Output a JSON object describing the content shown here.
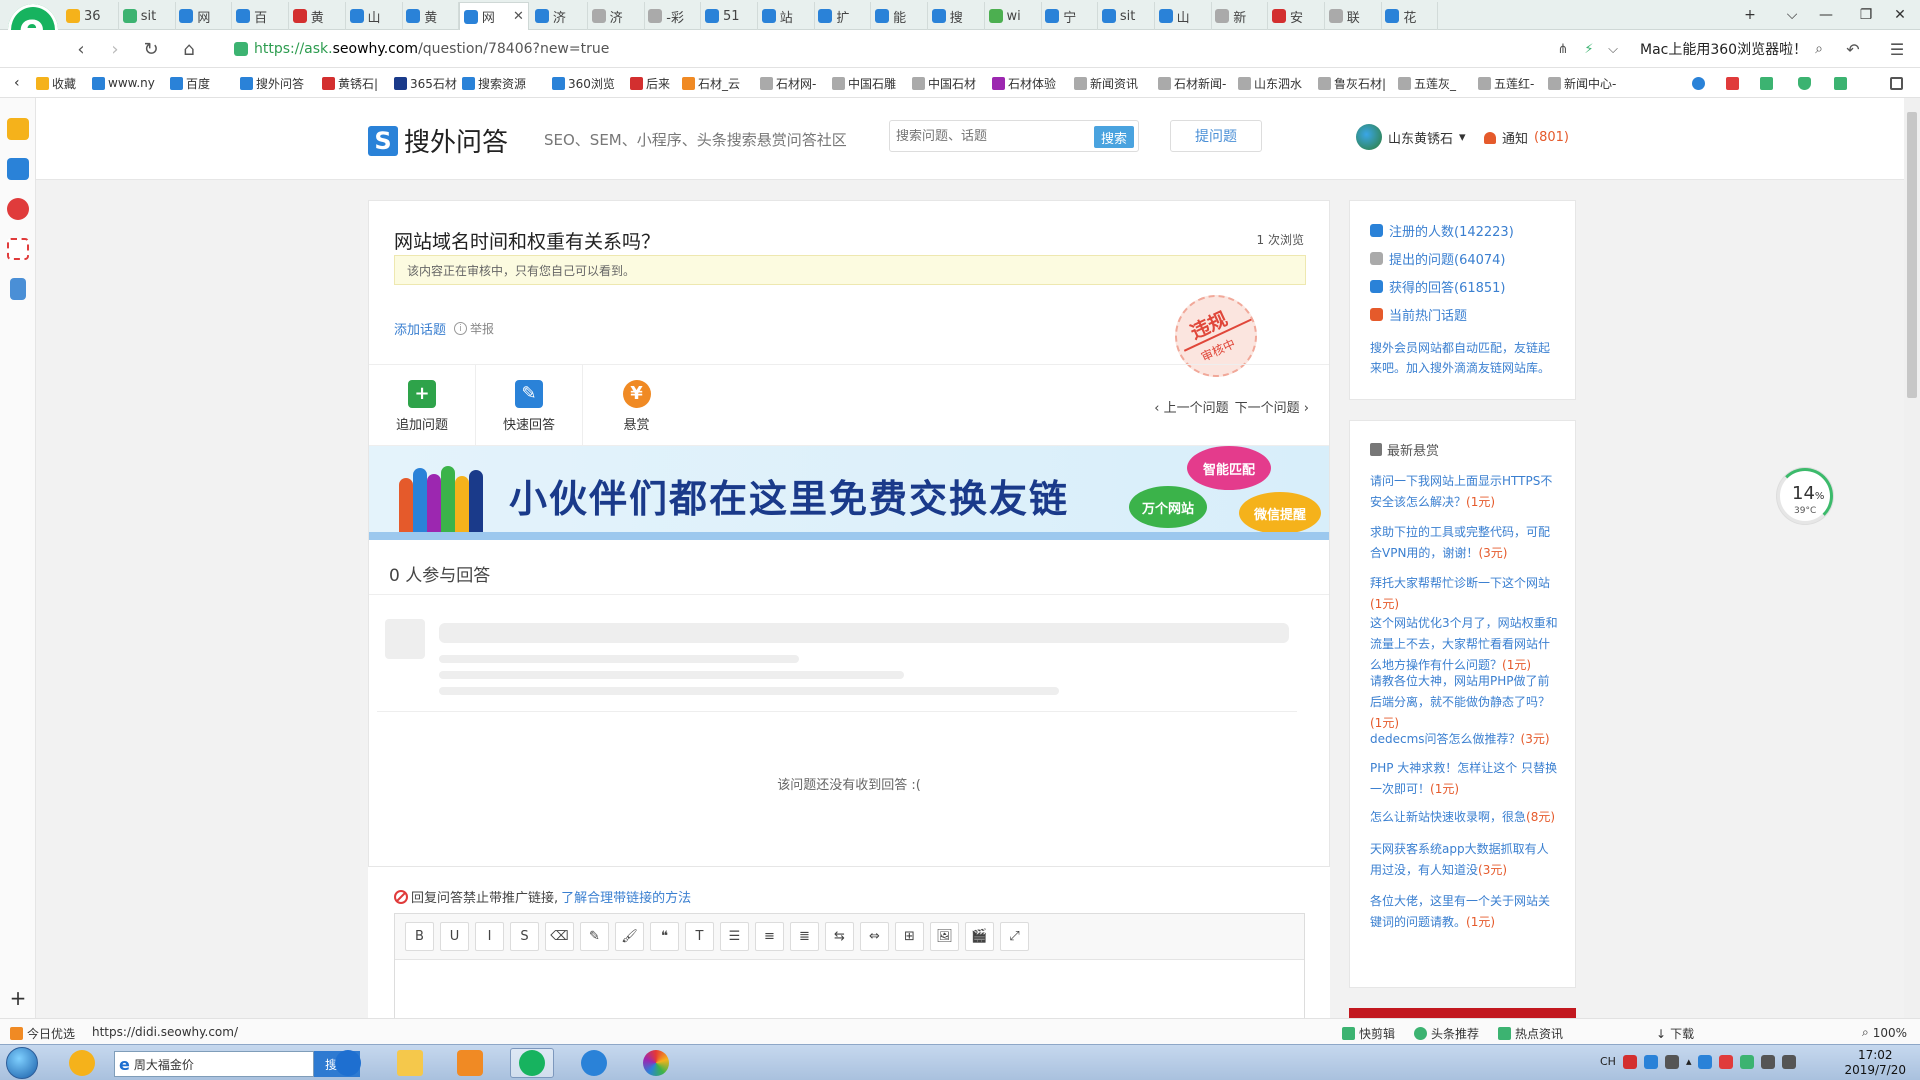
{
  "browser": {
    "tabs": [
      {
        "label": "36",
        "icon": "360-icon",
        "color": "#f5b21b"
      },
      {
        "label": "sit",
        "icon": "loading-icon",
        "color": "#3cb371"
      },
      {
        "label": "网",
        "icon": "chart-icon",
        "color": "#2a82d8"
      },
      {
        "label": "百",
        "icon": "baidu-icon",
        "color": "#2a82d8"
      },
      {
        "label": "黄",
        "icon": "site-icon",
        "color": "#d32f2f"
      },
      {
        "label": "山",
        "icon": "s-icon",
        "color": "#2a82d8"
      },
      {
        "label": "黄",
        "icon": "baidu-icon",
        "color": "#2a82d8"
      },
      {
        "label": "网",
        "icon": "s-icon",
        "color": "#2a82d8"
      },
      {
        "label": "济",
        "icon": "baidu-icon",
        "color": "#2a82d8"
      },
      {
        "label": "济",
        "icon": "page-icon",
        "color": "#aaaaaa"
      },
      {
        "label": "-彩",
        "icon": "page-icon",
        "color": "#aaaaaa"
      },
      {
        "label": "51",
        "icon": "baidu-icon",
        "color": "#2a82d8"
      },
      {
        "label": "站",
        "icon": "seo-icon",
        "color": "#2a82d8"
      },
      {
        "label": "扩",
        "icon": "seo-icon",
        "color": "#2a82d8"
      },
      {
        "label": "能",
        "icon": "baidu-icon",
        "color": "#2a82d8"
      },
      {
        "label": "搜",
        "icon": "baidu-icon",
        "color": "#2a82d8"
      },
      {
        "label": "wi",
        "icon": "wiki-icon",
        "color": "#4caf50"
      },
      {
        "label": "宁",
        "icon": "baidu-icon",
        "color": "#2a82d8"
      },
      {
        "label": "sit",
        "icon": "baidu-icon",
        "color": "#2a82d8"
      },
      {
        "label": "山",
        "icon": "baidu-icon",
        "color": "#2a82d8"
      },
      {
        "label": "新",
        "icon": "page-icon",
        "color": "#aaaaaa"
      },
      {
        "label": "安",
        "icon": "site-icon",
        "color": "#d32f2f"
      },
      {
        "label": "联",
        "icon": "page-icon",
        "color": "#aaaaaa"
      },
      {
        "label": "花",
        "icon": "baidu-icon",
        "color": "#2a82d8"
      }
    ],
    "active_tab_index": 7,
    "url_green": "https://ask.",
    "url_dark": "seowhy.com",
    "url_rest": "/question/78406?new=true",
    "promo_text": "Mac上能用360浏览器啦！",
    "bookmarks": [
      {
        "label": "收藏",
        "color": "#f5b21b"
      },
      {
        "label": "www.ny",
        "color": "#2a82d8"
      },
      {
        "label": "百度",
        "color": "#2a82d8"
      },
      {
        "label": "搜外问答",
        "color": "#2a82d8"
      },
      {
        "label": "黄锈石|",
        "color": "#d32f2f"
      },
      {
        "label": "365石材",
        "color": "#1a3a8a"
      },
      {
        "label": "搜索资源",
        "color": "#2a82d8"
      },
      {
        "label": "360浏览",
        "color": "#2a82d8"
      },
      {
        "label": "后来",
        "color": "#d32f2f"
      },
      {
        "label": "石材_云",
        "color": "#f08a24"
      },
      {
        "label": "石材网-",
        "color": "#aaaaaa"
      },
      {
        "label": "中国石雕",
        "color": "#aaaaaa"
      },
      {
        "label": "中国石材",
        "color": "#aaaaaa"
      },
      {
        "label": "石材体验",
        "color": "#9c27b0"
      },
      {
        "label": "新闻资讯",
        "color": "#aaaaaa"
      },
      {
        "label": "石材新闻-",
        "color": "#aaaaaa"
      },
      {
        "label": "山东泗水",
        "color": "#aaaaaa"
      },
      {
        "label": "鲁灰石材|",
        "color": "#aaaaaa"
      },
      {
        "label": "五莲灰_",
        "color": "#aaaaaa"
      },
      {
        "label": "五莲红-",
        "color": "#aaaaaa"
      },
      {
        "label": "新闻中心-",
        "color": "#aaaaaa"
      }
    ]
  },
  "site": {
    "logo_letter": "S",
    "name": "搜外问答",
    "slogan": "SEO、SEM、小程序、头条搜索悬赏问答社区",
    "search_placeholder": "搜索问题、话题",
    "search_button": "搜索",
    "ask_button": "提问题",
    "username": "山东黄锈石",
    "notify_label": "通知",
    "notify_count": "(801)"
  },
  "question": {
    "title": "网站域名时间和权重有关系吗？",
    "views": "1 次浏览",
    "review_notice": "该内容正在审核中，只有您自己可以看到。",
    "add_topic": "添加话题",
    "report": "举报",
    "stamp_main": "违规",
    "stamp_sub": "审核中",
    "actions": [
      {
        "label": "追加问题",
        "icon": "add-question-icon",
        "color": "#2ea34a"
      },
      {
        "label": "快速回答",
        "icon": "quick-answer-icon",
        "color": "#2a82d8"
      },
      {
        "label": "悬赏",
        "icon": "bounty-bag-icon",
        "color": "#f08a24"
      }
    ],
    "prev": "上一个问题",
    "next": "下一个问题",
    "banner_slogan": "小伙伴们都在这里免费交换友链",
    "banner_tags": [
      "智能匹配",
      "万个网站",
      "微信提醒"
    ],
    "answers_count": "0 人参与回答",
    "no_answer": "该问题还没有收到回答 :(",
    "reply_notice": "回复问答禁止带推广链接,",
    "reply_link": "了解合理带链接的方法",
    "editor_tools": [
      "B",
      "U",
      "I",
      "S",
      "⌫",
      "✎",
      "🖌",
      "❝",
      "T",
      "☰",
      "≡",
      "≣",
      "⇆",
      "⇔",
      "⊞",
      "🖼",
      "🎬",
      "⤢"
    ]
  },
  "stats": {
    "items": [
      {
        "label": "注册的人数(142223)",
        "icon": "users-icon",
        "color": "#2a82d8"
      },
      {
        "label": "提出的问题(64074)",
        "icon": "chat-icon",
        "color": "#aaaaaa"
      },
      {
        "label": "获得的回答(61851)",
        "icon": "edit-icon",
        "color": "#2a82d8"
      },
      {
        "label": "当前热门话题",
        "icon": "fire-icon",
        "color": "#e55a2b"
      }
    ],
    "info": "搜外会员网站都自动匹配，友链起来吧。加入搜外滴滴友链网站库。"
  },
  "bounty": {
    "heading": "最新悬赏",
    "items": [
      {
        "text": "请问一下我网站上面显示HTTPS不安全该怎么解决？",
        "reward": "(1元)"
      },
      {
        "text": "求助下拉的工具或完整代码，可配合VPN用的，谢谢！",
        "reward": "(3元)"
      },
      {
        "text": "拜托大家帮帮忙诊断一下这个网站",
        "reward": "(1元)"
      },
      {
        "text": "这个网站优化3个月了，网站权重和流量上不去，大家帮忙看看网站什么地方操作有什么问题？",
        "reward": "(1元)"
      },
      {
        "text": "请教各位大神，网站用PHP做了前后端分离，就不能做伪静态了吗？",
        "reward": "(1元)"
      },
      {
        "text": "dedecms问答怎么做推荐？",
        "reward": "(3元)"
      },
      {
        "text": "PHP 大神求救！怎样让这个 只替换一次即可！",
        "reward": "(1元)"
      },
      {
        "text": "怎么让新站快速收录啊，很急",
        "reward": "(8元)"
      },
      {
        "text": "天网获客系统app大数据抓取有人用过没，有人知道没",
        "reward": "(3元)"
      },
      {
        "text": "各位大佬，这里有一个关于网站关键词的问题请教。",
        "reward": "(1元)"
      }
    ]
  },
  "weather": {
    "percent": "14",
    "percent_unit": "%",
    "temp": "39°C"
  },
  "statusbar": {
    "left_label": "今日优选",
    "hover_url": "https://didi.seowhy.com/",
    "items": [
      "快剪辑",
      "头条推荐",
      "热点资讯",
      "下载"
    ],
    "zoom": "100%"
  },
  "taskbar": {
    "search_value": "周大福金价",
    "search_button": "搜索",
    "lang": "CH",
    "time": "17:02",
    "date": "2019/7/20"
  }
}
